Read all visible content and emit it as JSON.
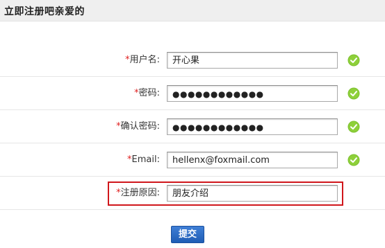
{
  "header": {
    "title": "立即注册吧亲爱的"
  },
  "form": {
    "required_mark": "*",
    "fields": [
      {
        "label": "用户名:",
        "value": "开心果",
        "valid": true
      },
      {
        "label": "密码:",
        "value": "●●●●●●●●●●●●",
        "valid": true
      },
      {
        "label": "确认密码:",
        "value": "●●●●●●●●●●●●",
        "valid": true
      },
      {
        "label": "Email:",
        "value": "hellenx@foxmail.com",
        "valid": true
      },
      {
        "label": "注册原因:",
        "value": "朋友介绍",
        "valid": false
      }
    ],
    "submit_label": "提交"
  },
  "colors": {
    "required": "#e02020",
    "highlight_border": "#d0161b",
    "check_green": "#7cc02f",
    "submit_blue": "#2d6fc9"
  },
  "icons": {
    "valid": "check-circle-icon"
  }
}
